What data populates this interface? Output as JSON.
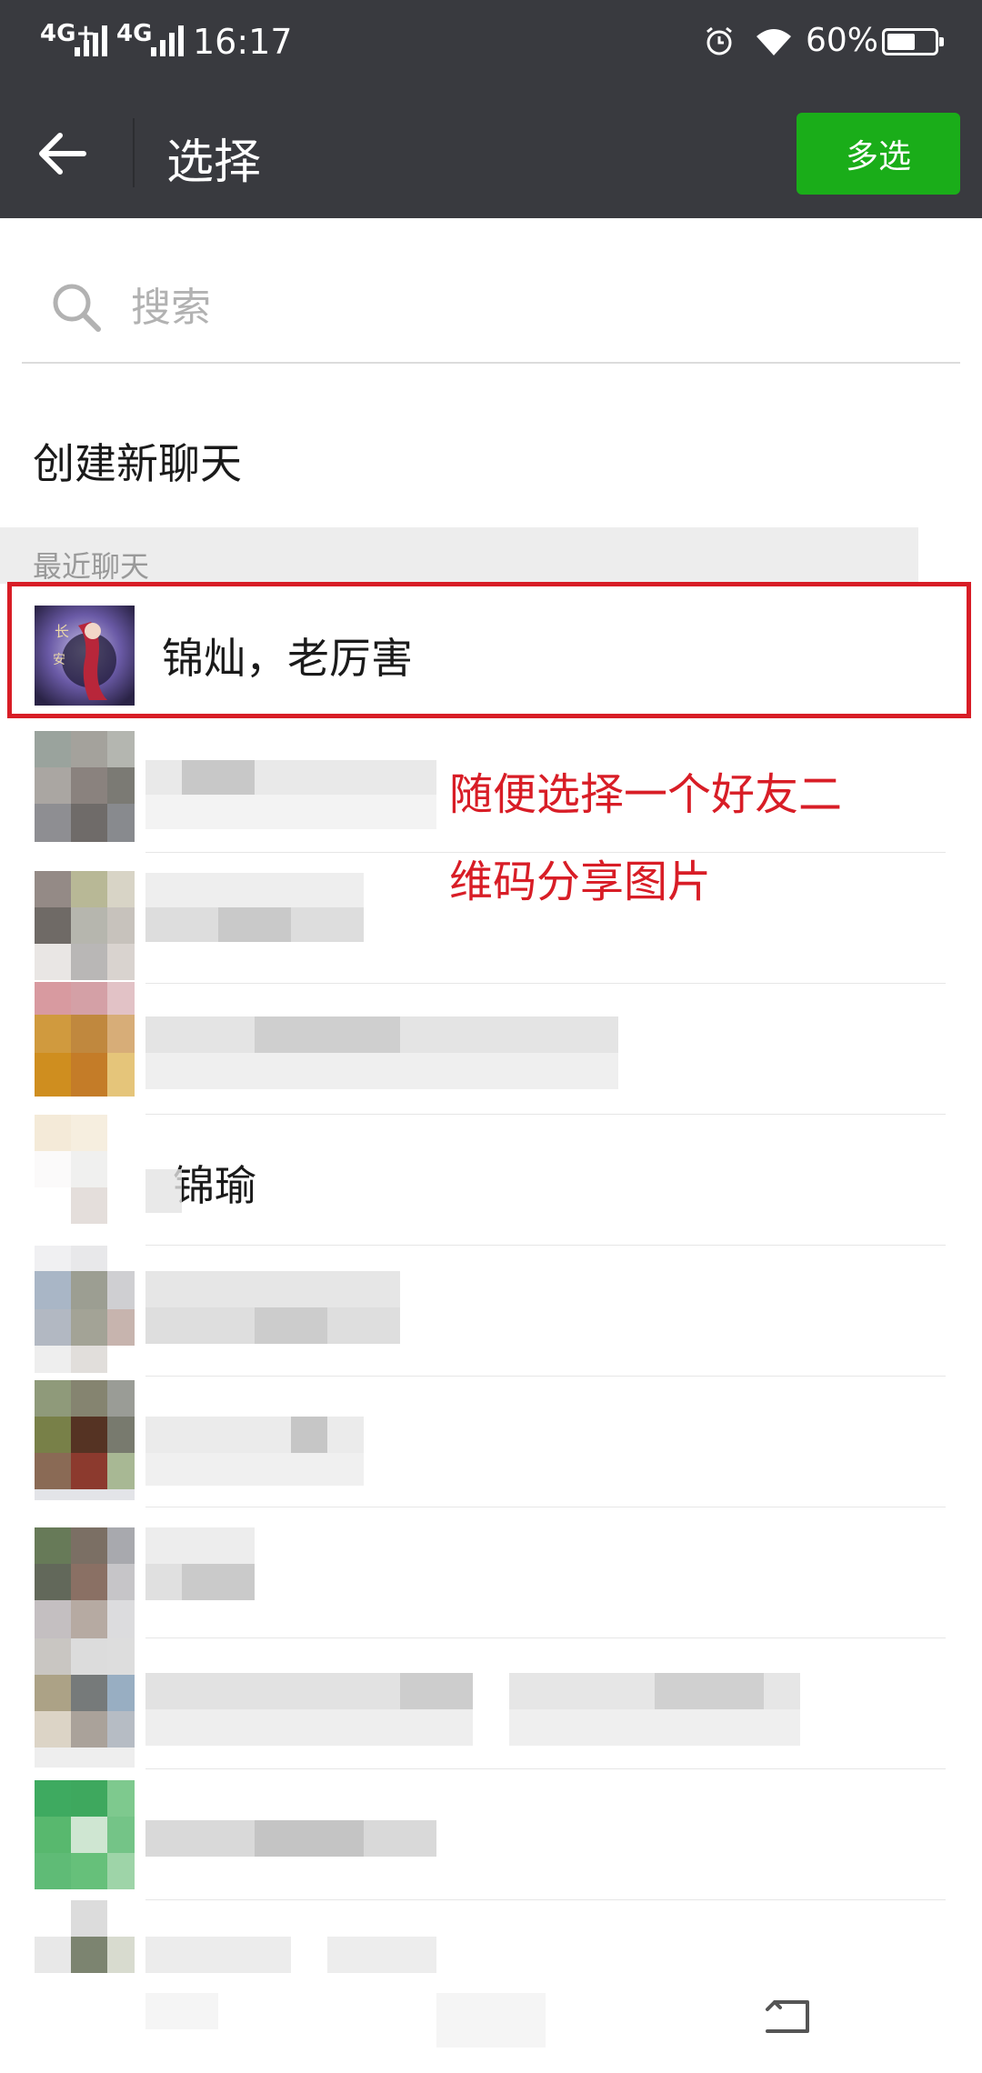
{
  "status_bar": {
    "signal_1": "4G+",
    "signal_2": "4G",
    "time": "16:17",
    "battery_text": "60%",
    "battery_level": 0.6,
    "icons": [
      "alarm-icon",
      "wifi-icon",
      "battery-icon"
    ]
  },
  "title_bar": {
    "title": "选择",
    "multi_select_label": "多选",
    "back_icon": "arrow-left-icon"
  },
  "search": {
    "placeholder": "搜索",
    "value": ""
  },
  "create_chat": {
    "label": "创建新聊天"
  },
  "recent_header": "最近聊天",
  "chats": [
    {
      "name": "锦灿，老厉害",
      "avatar": "anime-avatar"
    },
    {
      "name": "",
      "avatar": "pixelated"
    },
    {
      "name": "",
      "avatar": "pixelated"
    },
    {
      "name": "",
      "avatar": "pixelated"
    },
    {
      "name": "锦瑜",
      "avatar": "pixelated"
    },
    {
      "name": "",
      "avatar": "pixelated"
    },
    {
      "name": "",
      "avatar": "pixelated"
    },
    {
      "name": "",
      "avatar": "pixelated"
    },
    {
      "name": "",
      "avatar": "pixelated"
    },
    {
      "name": "",
      "avatar": "pixelated"
    }
  ],
  "annotation": {
    "line1": "随便选择一个好友二",
    "line2": "维码分享图片"
  },
  "colors": {
    "header_bg": "#393a3f",
    "accent_green": "#1aad19",
    "annotation_red": "#d81d26"
  }
}
